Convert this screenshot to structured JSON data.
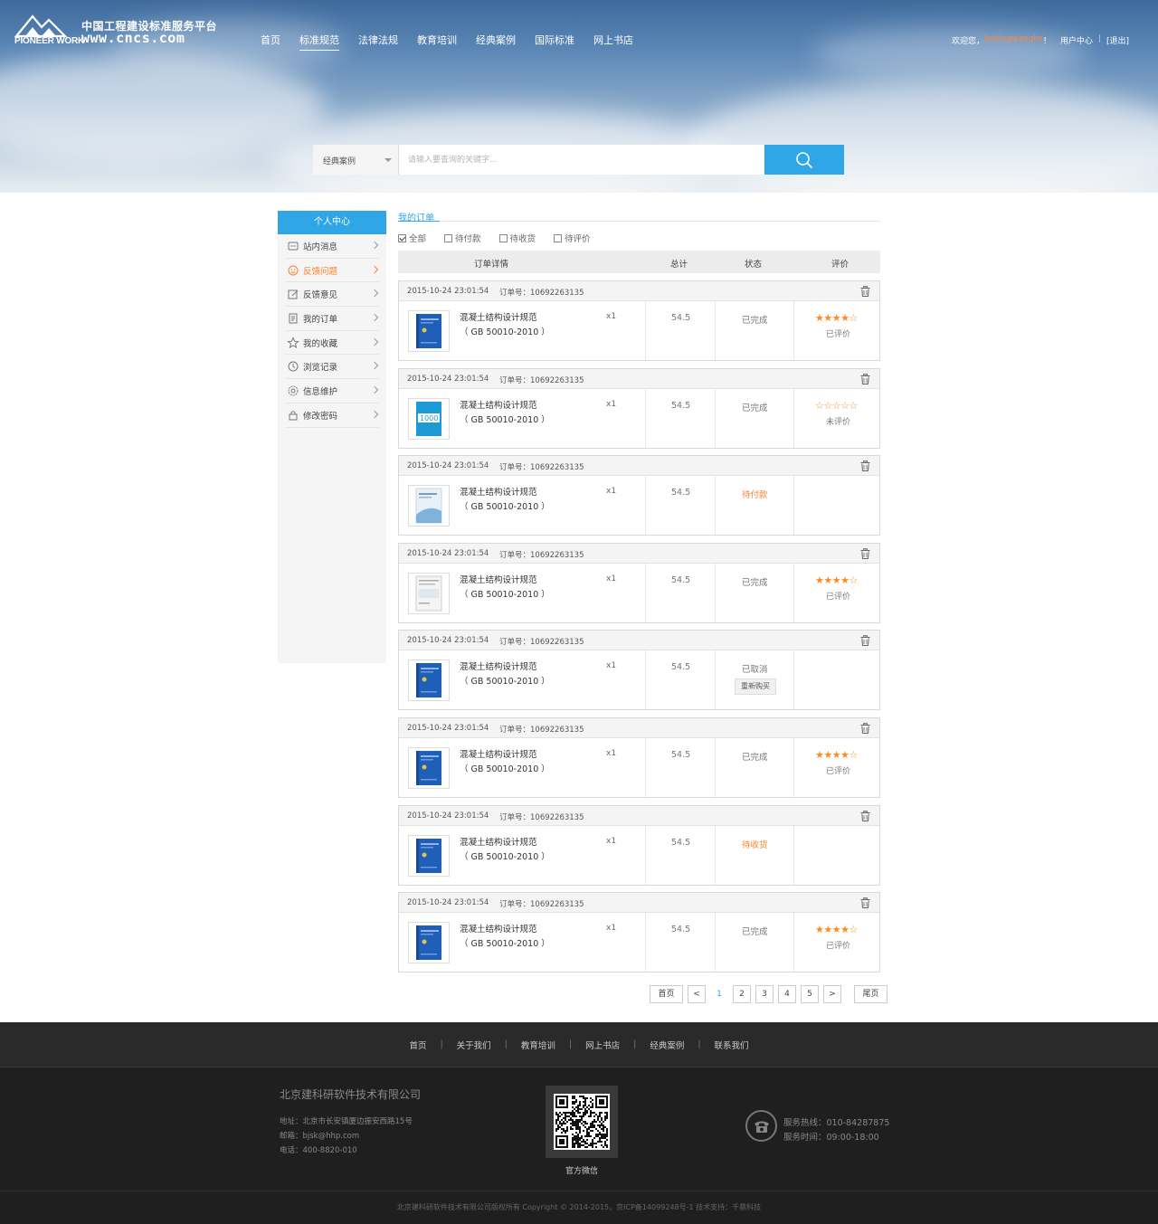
{
  "header": {
    "brand_cn": "中国工程建设标准服务平台",
    "brand_en": "PIONEER WORK",
    "brand_url": "www.cncs.com",
    "nav": [
      "首页",
      "标准规范",
      "法律法规",
      "教育培训",
      "经典案例",
      "国际标准",
      "网上书店"
    ],
    "nav_active_index": 1,
    "welcome": "欢迎您，",
    "username": "beijingwangke",
    "welcome_suffix": "！",
    "user_center": "用户中心",
    "sep": "|",
    "logout": "[退出]"
  },
  "search": {
    "category": "经典案例",
    "placeholder": "请输入要查询的关键字...",
    "button_icon": "search-icon"
  },
  "sidebar": {
    "title": "个人中心",
    "items": [
      {
        "label": "站内消息",
        "icon": "message-icon"
      },
      {
        "label": "反馈问题",
        "icon": "feedback-icon",
        "active": true
      },
      {
        "label": "反馈意见",
        "icon": "edit-icon"
      },
      {
        "label": "我的订单",
        "icon": "order-icon"
      },
      {
        "label": "我的收藏",
        "icon": "star-icon"
      },
      {
        "label": "浏览记录",
        "icon": "clock-icon"
      },
      {
        "label": "信息维护",
        "icon": "settings-icon"
      },
      {
        "label": "修改密码",
        "icon": "lock-icon"
      }
    ]
  },
  "orders_panel": {
    "title": "我的订单",
    "filters": [
      {
        "label": "全部",
        "checked": true
      },
      {
        "label": "待付款",
        "checked": false
      },
      {
        "label": "待收货",
        "checked": false
      },
      {
        "label": "待评价",
        "checked": false
      }
    ],
    "columns": [
      "订单详情",
      "总计",
      "状态",
      "评价"
    ]
  },
  "orders": [
    {
      "date": "2015-10-24 23:01:54",
      "order_no": "订单号：10692263135",
      "name": "混凝土结构设计规范",
      "code": "（ GB 50010-2010 ）",
      "qty": "x1",
      "price": "54.5",
      "status": "已完成",
      "status_color": "#777777",
      "stars": "★★★★☆",
      "rating": 4,
      "rate_text": "已评价",
      "cover": "blue"
    },
    {
      "date": "2015-10-24 23:01:54",
      "order_no": "订单号：10692263135",
      "name": "混凝土结构设计规范",
      "code": "（ GB 50010-2010 ）",
      "qty": "x1",
      "price": "54.5",
      "status": "已完成",
      "status_color": "#777777",
      "stars": "☆☆☆☆☆",
      "rating": 0,
      "rate_text": "未评价",
      "cover": "cyan"
    },
    {
      "date": "2015-10-24 23:01:54",
      "order_no": "订单号：10692263135",
      "name": "混凝土结构设计规范",
      "code": "（ GB 50010-2010 ）",
      "qty": "x1",
      "price": "54.5",
      "status": "待付款",
      "status_color": "#ff7f2a",
      "stars": "",
      "rating": null,
      "rate_text": "",
      "cover": "lightblue"
    },
    {
      "date": "2015-10-24 23:01:54",
      "order_no": "订单号：10692263135",
      "name": "混凝土结构设计规范",
      "code": "（ GB 50010-2010 ）",
      "qty": "x1",
      "price": "54.5",
      "status": "已完成",
      "status_color": "#777777",
      "stars": "★★★★☆",
      "rating": 4,
      "rate_text": "已评价",
      "cover": "white"
    },
    {
      "date": "2015-10-24 23:01:54",
      "order_no": "订单号：10692263135",
      "name": "混凝土结构设计规范",
      "code": "（ GB 50010-2010 ）",
      "qty": "x1",
      "price": "54.5",
      "status": "已取消",
      "status_color": "#777777",
      "stars": "",
      "rating": null,
      "rate_text": "",
      "rebuy": "重新购买",
      "cover": "blue"
    },
    {
      "date": "2015-10-24 23:01:54",
      "order_no": "订单号：10692263135",
      "name": "混凝土结构设计规范",
      "code": "（ GB 50010-2010 ）",
      "qty": "x1",
      "price": "54.5",
      "status": "已完成",
      "status_color": "#777777",
      "stars": "★★★★☆",
      "rating": 4,
      "rate_text": "已评价",
      "cover": "blue"
    },
    {
      "date": "2015-10-24 23:01:54",
      "order_no": "订单号：10692263135",
      "name": "混凝土结构设计规范",
      "code": "（ GB 50010-2010 ）",
      "qty": "x1",
      "price": "54.5",
      "status": "待收货",
      "status_color": "#ff7f2a",
      "stars": "",
      "rating": null,
      "rate_text": "",
      "cover": "blue"
    },
    {
      "date": "2015-10-24 23:01:54",
      "order_no": "订单号：10692263135",
      "name": "混凝土结构设计规范",
      "code": "（ GB 50010-2010 ）",
      "qty": "x1",
      "price": "54.5",
      "status": "已完成",
      "status_color": "#777777",
      "stars": "★★★★☆",
      "rating": 4,
      "rate_text": "已评价",
      "cover": "blue"
    }
  ],
  "pager": {
    "first": "首页",
    "prev": "<",
    "pages": [
      "1",
      "2",
      "3",
      "4",
      "5"
    ],
    "current": "1",
    "next": ">",
    "last": "尾页"
  },
  "footer": {
    "nav": [
      "首页",
      "关于我们",
      "教育培训",
      "网上书店",
      "经典案例",
      "联系我们"
    ],
    "nav_sep": "|",
    "company": "北京建科研软件技术有限公司",
    "address": "地址：北京市长安镇厦边振安西路15号",
    "email": "邮箱：bjsk@hhp.com",
    "phone": "电话：400-8820-010",
    "qr_caption": "官方微信",
    "hotline": "服务热线：010-84287875",
    "hours": "服务时间：09:00-18:00",
    "copyright": "北京建科研软件技术有限公司版权所有    Copyright © 2014-2015，京ICP备14099248号-1  技术支持：千鼎科技"
  },
  "colors": {
    "accent": "#2fa6e6",
    "orange": "#ff7f2a",
    "footer_bg": "#1f1f1f"
  }
}
